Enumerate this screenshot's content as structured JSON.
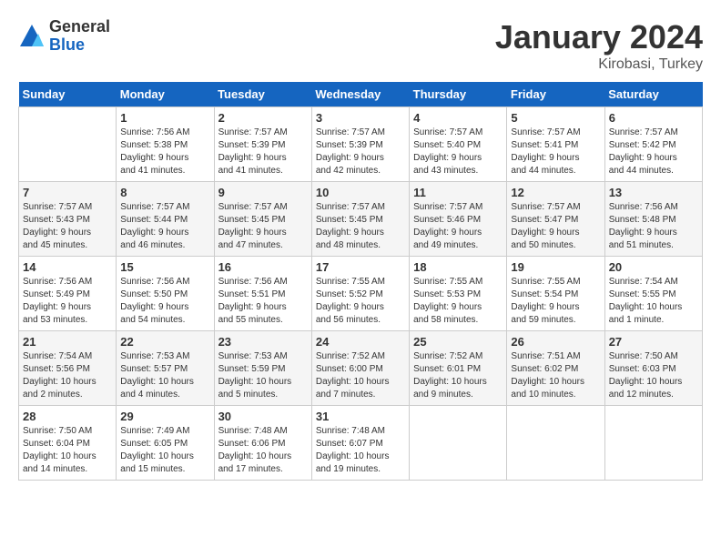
{
  "logo": {
    "general": "General",
    "blue": "Blue"
  },
  "title": "January 2024",
  "subtitle": "Kirobasi, Turkey",
  "headers": [
    "Sunday",
    "Monday",
    "Tuesday",
    "Wednesday",
    "Thursday",
    "Friday",
    "Saturday"
  ],
  "weeks": [
    [
      {
        "day": "",
        "content": ""
      },
      {
        "day": "1",
        "content": "Sunrise: 7:56 AM\nSunset: 5:38 PM\nDaylight: 9 hours\nand 41 minutes."
      },
      {
        "day": "2",
        "content": "Sunrise: 7:57 AM\nSunset: 5:39 PM\nDaylight: 9 hours\nand 41 minutes."
      },
      {
        "day": "3",
        "content": "Sunrise: 7:57 AM\nSunset: 5:39 PM\nDaylight: 9 hours\nand 42 minutes."
      },
      {
        "day": "4",
        "content": "Sunrise: 7:57 AM\nSunset: 5:40 PM\nDaylight: 9 hours\nand 43 minutes."
      },
      {
        "day": "5",
        "content": "Sunrise: 7:57 AM\nSunset: 5:41 PM\nDaylight: 9 hours\nand 44 minutes."
      },
      {
        "day": "6",
        "content": "Sunrise: 7:57 AM\nSunset: 5:42 PM\nDaylight: 9 hours\nand 44 minutes."
      }
    ],
    [
      {
        "day": "7",
        "content": "Sunrise: 7:57 AM\nSunset: 5:43 PM\nDaylight: 9 hours\nand 45 minutes."
      },
      {
        "day": "8",
        "content": "Sunrise: 7:57 AM\nSunset: 5:44 PM\nDaylight: 9 hours\nand 46 minutes."
      },
      {
        "day": "9",
        "content": "Sunrise: 7:57 AM\nSunset: 5:45 PM\nDaylight: 9 hours\nand 47 minutes."
      },
      {
        "day": "10",
        "content": "Sunrise: 7:57 AM\nSunset: 5:45 PM\nDaylight: 9 hours\nand 48 minutes."
      },
      {
        "day": "11",
        "content": "Sunrise: 7:57 AM\nSunset: 5:46 PM\nDaylight: 9 hours\nand 49 minutes."
      },
      {
        "day": "12",
        "content": "Sunrise: 7:57 AM\nSunset: 5:47 PM\nDaylight: 9 hours\nand 50 minutes."
      },
      {
        "day": "13",
        "content": "Sunrise: 7:56 AM\nSunset: 5:48 PM\nDaylight: 9 hours\nand 51 minutes."
      }
    ],
    [
      {
        "day": "14",
        "content": "Sunrise: 7:56 AM\nSunset: 5:49 PM\nDaylight: 9 hours\nand 53 minutes."
      },
      {
        "day": "15",
        "content": "Sunrise: 7:56 AM\nSunset: 5:50 PM\nDaylight: 9 hours\nand 54 minutes."
      },
      {
        "day": "16",
        "content": "Sunrise: 7:56 AM\nSunset: 5:51 PM\nDaylight: 9 hours\nand 55 minutes."
      },
      {
        "day": "17",
        "content": "Sunrise: 7:55 AM\nSunset: 5:52 PM\nDaylight: 9 hours\nand 56 minutes."
      },
      {
        "day": "18",
        "content": "Sunrise: 7:55 AM\nSunset: 5:53 PM\nDaylight: 9 hours\nand 58 minutes."
      },
      {
        "day": "19",
        "content": "Sunrise: 7:55 AM\nSunset: 5:54 PM\nDaylight: 9 hours\nand 59 minutes."
      },
      {
        "day": "20",
        "content": "Sunrise: 7:54 AM\nSunset: 5:55 PM\nDaylight: 10 hours\nand 1 minute."
      }
    ],
    [
      {
        "day": "21",
        "content": "Sunrise: 7:54 AM\nSunset: 5:56 PM\nDaylight: 10 hours\nand 2 minutes."
      },
      {
        "day": "22",
        "content": "Sunrise: 7:53 AM\nSunset: 5:57 PM\nDaylight: 10 hours\nand 4 minutes."
      },
      {
        "day": "23",
        "content": "Sunrise: 7:53 AM\nSunset: 5:59 PM\nDaylight: 10 hours\nand 5 minutes."
      },
      {
        "day": "24",
        "content": "Sunrise: 7:52 AM\nSunset: 6:00 PM\nDaylight: 10 hours\nand 7 minutes."
      },
      {
        "day": "25",
        "content": "Sunrise: 7:52 AM\nSunset: 6:01 PM\nDaylight: 10 hours\nand 9 minutes."
      },
      {
        "day": "26",
        "content": "Sunrise: 7:51 AM\nSunset: 6:02 PM\nDaylight: 10 hours\nand 10 minutes."
      },
      {
        "day": "27",
        "content": "Sunrise: 7:50 AM\nSunset: 6:03 PM\nDaylight: 10 hours\nand 12 minutes."
      }
    ],
    [
      {
        "day": "28",
        "content": "Sunrise: 7:50 AM\nSunset: 6:04 PM\nDaylight: 10 hours\nand 14 minutes."
      },
      {
        "day": "29",
        "content": "Sunrise: 7:49 AM\nSunset: 6:05 PM\nDaylight: 10 hours\nand 15 minutes."
      },
      {
        "day": "30",
        "content": "Sunrise: 7:48 AM\nSunset: 6:06 PM\nDaylight: 10 hours\nand 17 minutes."
      },
      {
        "day": "31",
        "content": "Sunrise: 7:48 AM\nSunset: 6:07 PM\nDaylight: 10 hours\nand 19 minutes."
      },
      {
        "day": "",
        "content": ""
      },
      {
        "day": "",
        "content": ""
      },
      {
        "day": "",
        "content": ""
      }
    ]
  ]
}
